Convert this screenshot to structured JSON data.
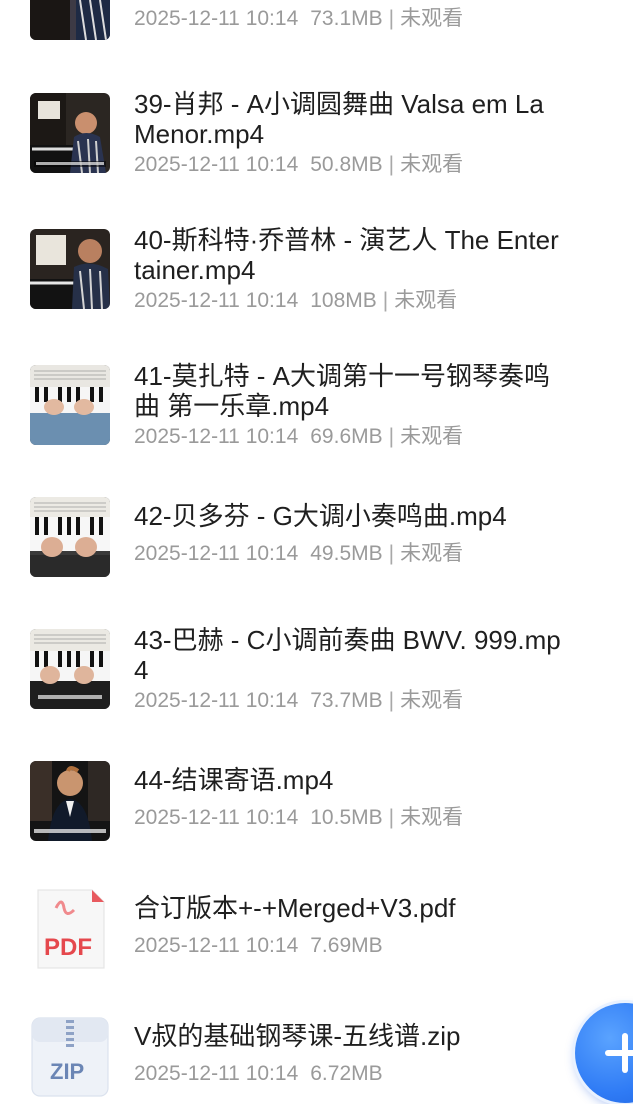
{
  "files": [
    {
      "title": "",
      "date": "2025-12-11 10:14",
      "size": "73.1MB",
      "status": "未观看",
      "thumb": "piano-player-icon"
    },
    {
      "title": "39-肖邦 - A小调圆舞曲 Valsa em La Menor.mp4",
      "date": "2025-12-11 10:14",
      "size": "50.8MB",
      "status": "未观看",
      "thumb": "piano-player-icon"
    },
    {
      "title": "40-斯科特·乔普林 - 演艺人 The Entertainer.mp4",
      "date": "2025-12-11 10:14",
      "size": "108MB",
      "status": "未观看",
      "thumb": "piano-player-icon"
    },
    {
      "title": "41-莫扎特 - A大调第十一号钢琴奏鸣曲 第一乐章.mp4",
      "date": "2025-12-11 10:14",
      "size": "69.6MB",
      "status": "未观看",
      "thumb": "piano-keys-icon"
    },
    {
      "title": "42-贝多芬 - G大调小奏鸣曲.mp4",
      "date": "2025-12-11 10:14",
      "size": "49.5MB",
      "status": "未观看",
      "thumb": "piano-keys-icon"
    },
    {
      "title": "43-巴赫 - C小调前奏曲 BWV. 999.mp4",
      "date": "2025-12-11 10:14",
      "size": "73.7MB",
      "status": "未观看",
      "thumb": "piano-keys-icon"
    },
    {
      "title": "44-结课寄语.mp4",
      "date": "2025-12-11 10:14",
      "size": "10.5MB",
      "status": "未观看",
      "thumb": "speaker-icon"
    },
    {
      "title": "合订版本+-+Merged+V3.pdf",
      "date": "2025-12-11 10:14",
      "size": "7.69MB",
      "status": "",
      "thumb": "pdf-file-icon",
      "badge": "PDF"
    },
    {
      "title": "V叔的基础钢琴课-五线谱.zip",
      "date": "2025-12-11 10:14",
      "size": "6.72MB",
      "status": "",
      "thumb": "zip-file-icon",
      "badge": "ZIP"
    }
  ],
  "fab": {
    "icon": "plus-icon"
  },
  "colors": {
    "title": "#1f1f1f",
    "meta": "#9a9a9a",
    "fab": "#2f7bf5",
    "pdf_red": "#e5484d",
    "zip_blue": "#6b86b5"
  }
}
